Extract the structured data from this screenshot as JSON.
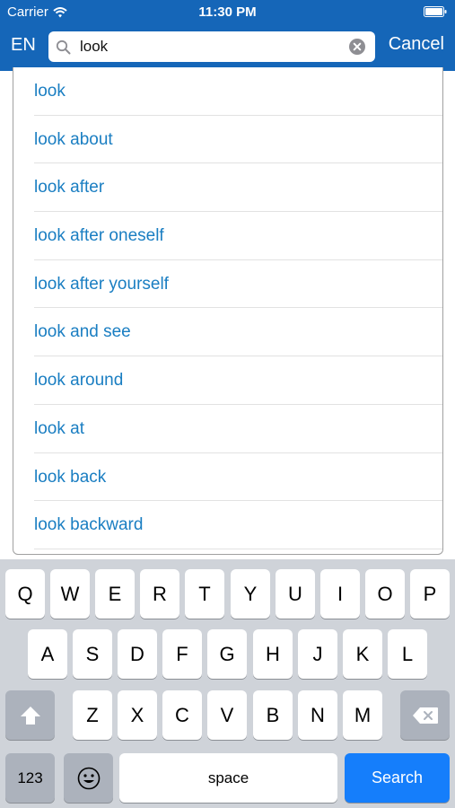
{
  "status": {
    "carrier": "Carrier",
    "time": "11:30 PM"
  },
  "nav": {
    "language": "EN",
    "search_value": "look",
    "cancel_label": "Cancel"
  },
  "suggestions": [
    "look",
    "look about",
    "look after",
    "look after oneself",
    "look after yourself",
    "look and see",
    "look around",
    "look at",
    "look back",
    "look backward"
  ],
  "keyboard": {
    "row1": [
      "Q",
      "W",
      "E",
      "R",
      "T",
      "Y",
      "U",
      "I",
      "O",
      "P"
    ],
    "row2": [
      "A",
      "S",
      "D",
      "F",
      "G",
      "H",
      "J",
      "K",
      "L"
    ],
    "row3": [
      "Z",
      "X",
      "C",
      "V",
      "B",
      "N",
      "M"
    ],
    "numbers_label": "123",
    "space_label": "space",
    "search_label": "Search"
  },
  "icons": {
    "wifi": "wifi-icon",
    "battery": "battery-icon",
    "search": "search-icon",
    "clear": "clear-icon",
    "shift": "shift-icon",
    "delete": "delete-icon",
    "emoji": "emoji-icon"
  },
  "colors": {
    "header": "#1566b8",
    "link": "#1a7ec2",
    "keyboard": "#cfd3d9",
    "search_key": "#157efb"
  }
}
